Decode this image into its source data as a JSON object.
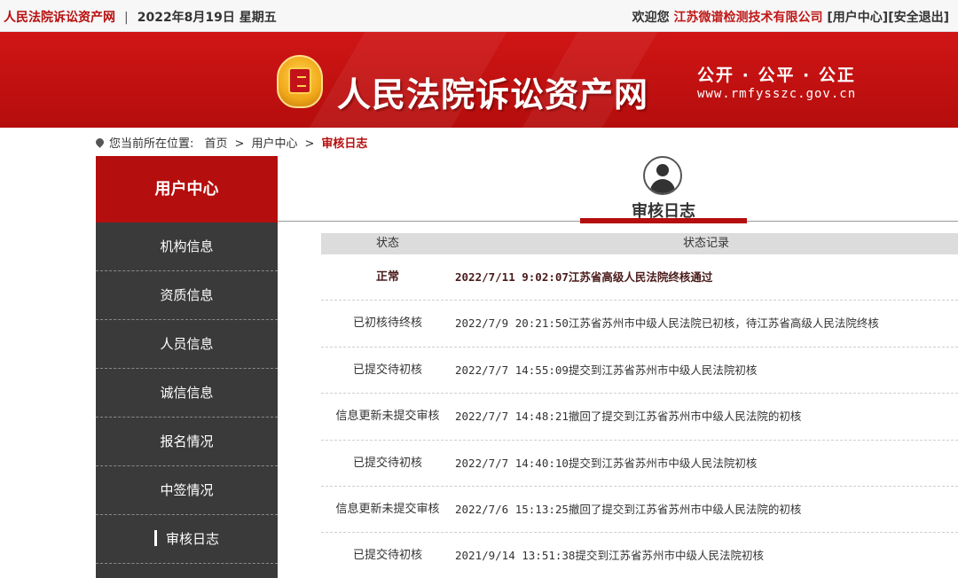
{
  "topbar": {
    "site_name": "人民法院诉讼资产网",
    "separator": "|",
    "date": "2022年8月19日  星期五",
    "welcome": "欢迎您",
    "company": "江苏微谱检测技术有限公司",
    "user_center_link": "[用户中心]",
    "logout_link": "[安全退出]"
  },
  "banner": {
    "title": "人民法院诉讼资产网",
    "slogan": "公开 · 公平 · 公正",
    "url": "www.rmfysszc.gov.cn"
  },
  "breadcrumb": {
    "prefix": "您当前所在位置:",
    "items": [
      "首页",
      "用户中心",
      "审核日志"
    ],
    "sep": ">"
  },
  "sidebar": {
    "title": "用户中心",
    "items": [
      {
        "label": "机构信息"
      },
      {
        "label": "资质信息"
      },
      {
        "label": "人员信息"
      },
      {
        "label": "诚信信息"
      },
      {
        "label": "报名情况"
      },
      {
        "label": "中签情况"
      },
      {
        "label": "审核日志",
        "active": true
      }
    ]
  },
  "main": {
    "title": "审核日志",
    "table": {
      "headers": [
        "状态",
        "状态记录"
      ],
      "rows": [
        {
          "status": "正常",
          "record": "2022/7/11 9:02:07江苏省高级人民法院终核通过"
        },
        {
          "status": "已初核待终核",
          "record": "2022/7/9 20:21:50江苏省苏州市中级人民法院已初核，待江苏省高级人民法院终核"
        },
        {
          "status": "已提交待初核",
          "record": "2022/7/7 14:55:09提交到江苏省苏州市中级人民法院初核"
        },
        {
          "status": "信息更新未提交审核",
          "record": "2022/7/7 14:48:21撤回了提交到江苏省苏州市中级人民法院的初核"
        },
        {
          "status": "已提交待初核",
          "record": "2022/7/7 14:40:10提交到江苏省苏州市中级人民法院初核"
        },
        {
          "status": "信息更新未提交审核",
          "record": "2022/7/6 15:13:25撤回了提交到江苏省苏州市中级人民法院的初核"
        },
        {
          "status": "已提交待初核",
          "record": "2021/9/14 13:51:38提交到江苏省苏州市中级人民法院初核"
        }
      ]
    }
  },
  "colors": {
    "brand_red": "#b50e0e",
    "sidebar_bg": "#3a3a3a",
    "table_header_bg": "#dcdcdc"
  }
}
